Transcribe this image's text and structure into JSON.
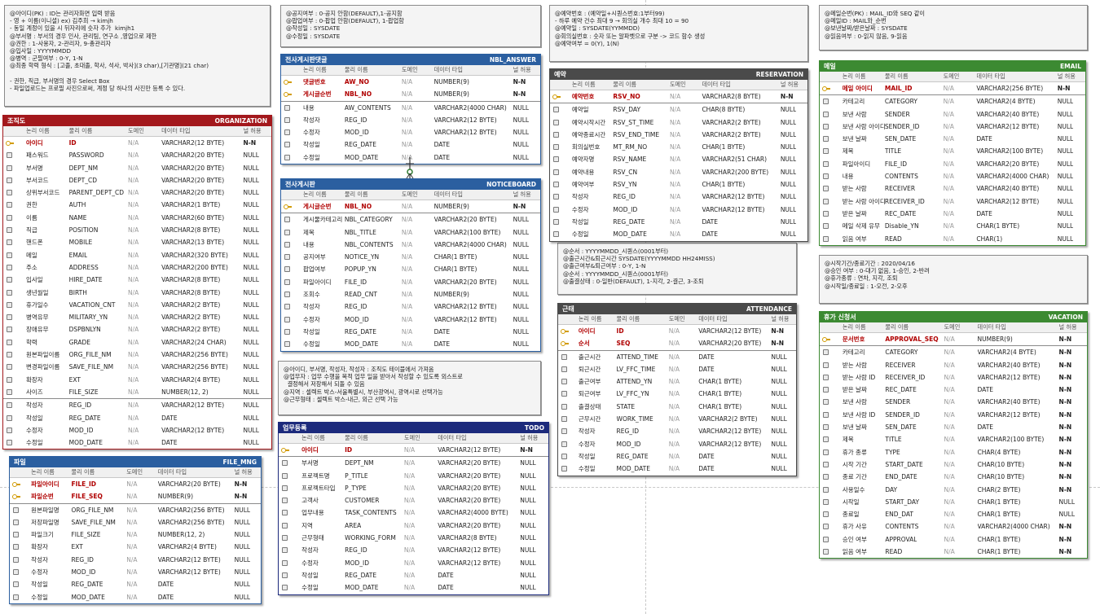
{
  "colors": {
    "red": "#a3181c",
    "blue": "#2b5fa0",
    "dark": "#4a4a4a",
    "green": "#3c8a32",
    "navy": "#1c2a7c"
  },
  "columns_header": [
    "논리 이름",
    "물리 이름",
    "도메인",
    "데이터 타입",
    "널 허용"
  ],
  "notes": {
    "org": [
      "@아이디(PK) : ID는 관리자화면 입력 받음",
      "- 영 + 이름(이니셜) ex) 김주희 → kimjh",
      "- 동일 계정이 있을 시 뒤자리에 숫자 추가  kimjh1",
      "@부서명 : 부서의 경우 인사, 관리팀, 연구소 ,영업으로 제한",
      "@권한 : 1-사용자, 2-관리자, 9-총관리자",
      "@입사일 : YYYYMMDD",
      "@병역 : 군필여부 : 0-Y, 1-N",
      "@최종 학력 형식 : [고졸, 초대졸, 학사, 석사, 박사](3 char),[기관명](21 char)",
      "",
      "- 권한, 직급, 부서명의 경우 Select Box",
      "- 파일업로드는 프로필 사진으로써, 계정 당 하나의 사진만 등록 수 있다."
    ],
    "notice_answer": [
      "@공지여부 : 0-공지 안함(DEFAULT),1-공지함",
      "@팝업여부 : 0-팝업 안함(DEFAULT), 1-팝업함",
      "@작성일 : SYSDATE",
      "@수정일 : SYSDATE"
    ],
    "reservation": [
      "@예약번호 : (예약일+시퀀스번호:1부터99)",
      "- 하루 예약 건수 최대 9 → 회의실 개수 최대 10 = 90",
      "@예약일 : SYSDATE(YYMMDD)",
      "@회의실번호 : 숫자 또는 알파벳으로 구분 -> 코드 함수 생성",
      "@예약여부 = 0(Y), 1(N)"
    ],
    "email": [
      "@메일순번(PK) : MAIL_ID와 SEQ 같이",
      "@메일ID : MAIL와_순번",
      "@보낸날짜/받은날짜 : SYSDATE",
      "@읽음여부 : 0-읽지 않음, 9-읽음"
    ],
    "todo": [
      "@아이디, 부서명, 작성자, 작성자 : 조직도 테이블에서 가져옴",
      "@업무자 : 업무 수행을 목적 업무 일을 받아서 작성할 수 있도록 외스트로",
      "  결정해서 저장해서 되돌 수 있음",
      "@지역 : 셀렉트 박스-서울특별시, 부산광역시, 광역시로 선택가능",
      "@근무형태 : 셀렉트 박스-내근, 외근 선택 가능"
    ],
    "attendance": [
      "@순서 : YYYYMMDD_시퀀스(0001부터)",
      "@출근시간&퇴근시간 SYSDATE(YYYYMMDD HH24MISS)",
      "@출근여부&퇴근여부 : 0-Y, 1-N",
      "@순서 : YYYYMMDD_시퀀스(0001부터)",
      "@출결상태 : 0-일반(DEFAULT), 1-지각, 2-결근, 3-조퇴"
    ],
    "vacation": [
      "@시작기간/종료기간 : 2020/04/16",
      "@승인 여부 : 0-대기 없음, 1-승인, 2-반려",
      "@휴가종류 : 연차, 지각, 조퇴",
      "@시작일/종료일 : 1-오전, 2-오후"
    ]
  },
  "entities": {
    "organization": {
      "kname": "조직도",
      "pname": "ORGANIZATION",
      "rows": [
        [
          "아이디",
          "ID",
          "N/A",
          "VARCHAR2(12 BYTE)",
          "N-N",
          "pk"
        ],
        [
          "패스워드",
          "PASSWORD",
          "N/A",
          "VARCHAR2(20 BYTE)",
          "NULL",
          ""
        ],
        [
          "부서명",
          "DEPT_NM",
          "N/A",
          "VARCHAR2(20 BYTE)",
          "NULL",
          ""
        ],
        [
          "부서코드",
          "DEPT_CD",
          "N/A",
          "VARCHAR2(20 BYTE)",
          "NULL",
          ""
        ],
        [
          "상위부서코드",
          "PARENT_DEPT_CD",
          "N/A",
          "VARCHAR2(20 BYTE)",
          "NULL",
          ""
        ],
        [
          "권한",
          "AUTH",
          "N/A",
          "VARCHAR2(1 BYTE)",
          "NULL",
          ""
        ],
        [
          "이름",
          "NAME",
          "N/A",
          "VARCHAR2(60 BYTE)",
          "NULL",
          ""
        ],
        [
          "직급",
          "POSITION",
          "N/A",
          "VARCHAR2(8 BYTE)",
          "NULL",
          ""
        ],
        [
          "핸드폰",
          "MOBILE",
          "N/A",
          "VARCHAR2(13 BYTE)",
          "NULL",
          ""
        ],
        [
          "메일",
          "EMAIL",
          "N/A",
          "VARCHAR2(320 BYTE)",
          "NULL",
          ""
        ],
        [
          "주소",
          "ADDRESS",
          "N/A",
          "VARCHAR2(200 BYTE)",
          "NULL",
          ""
        ],
        [
          "입사일",
          "HIRE_DATE",
          "N/A",
          "VARCHAR2(8 BYTE)",
          "NULL",
          ""
        ],
        [
          "생년월일",
          "BIRTH",
          "N/A",
          "VARCHAR2(8 BYTE)",
          "NULL",
          ""
        ],
        [
          "휴가일수",
          "VACATION_CNT",
          "N/A",
          "VARCHAR2(2 BYTE)",
          "NULL",
          ""
        ],
        [
          "병역유무",
          "MILITARY_YN",
          "N/A",
          "VARCHAR2(2 BYTE)",
          "NULL",
          ""
        ],
        [
          "장애유무",
          "DSPBNLYN",
          "N/A",
          "VARCHAR2(2 BYTE)",
          "NULL",
          ""
        ],
        [
          "학력",
          "GRADE",
          "N/A",
          "VARCHAR2(24 CHAR)",
          "NULL",
          ""
        ],
        [
          "원본파일이름",
          "ORG_FILE_NM",
          "N/A",
          "VARCHAR2(256 BYTE)",
          "NULL",
          ""
        ],
        [
          "변경파일이름",
          "SAVE_FILE_NM",
          "N/A",
          "VARCHAR2(256 BYTE)",
          "NULL",
          ""
        ],
        [
          "확장자",
          "EXT",
          "N/A",
          "VARCHAR2(4 BYTE)",
          "NULL",
          ""
        ],
        [
          "사이즈",
          "FILE_SIZE",
          "N/A",
          "NUMBER(12, 2)",
          "NULL",
          ""
        ],
        [
          "작성자",
          "REG_ID",
          "N/A",
          "VARCHAR2(12 BYTE)",
          "NULL",
          "sep"
        ],
        [
          "작성일",
          "REG_DATE",
          "N/A",
          "DATE",
          "NULL",
          ""
        ],
        [
          "수정자",
          "MOD_ID",
          "N/A",
          "VARCHAR2(12 BYTE)",
          "NULL",
          ""
        ],
        [
          "수정일",
          "MOD_DATE",
          "N/A",
          "DATE",
          "NULL",
          ""
        ]
      ]
    },
    "file_mng": {
      "kname": "파일",
      "pname": "FILE_MNG",
      "rows": [
        [
          "파일아이디",
          "FILE_ID",
          "N/A",
          "VARCHAR2(20 BYTE)",
          "N-N",
          "pk"
        ],
        [
          "파일순번",
          "FILE_SEQ",
          "N/A",
          "NUMBER(9)",
          "N-N",
          "pk"
        ],
        [
          "원본파일명",
          "ORG_FILE_NM",
          "N/A",
          "VARCHAR2(256 BYTE)",
          "NULL",
          "sep"
        ],
        [
          "저장파일명",
          "SAVE_FILE_NM",
          "N/A",
          "VARCHAR2(256 BYTE)",
          "NULL",
          ""
        ],
        [
          "파일크기",
          "FILE_SIZE",
          "N/A",
          "NUMBER(12, 2)",
          "NULL",
          ""
        ],
        [
          "확장자",
          "EXT",
          "N/A",
          "VARCHAR2(4 BYTE)",
          "NULL",
          ""
        ],
        [
          "작성자",
          "REG_ID",
          "N/A",
          "VARCHAR2(12 BYTE)",
          "NULL",
          ""
        ],
        [
          "수정자",
          "MOD_ID",
          "N/A",
          "VARCHAR2(12 BYTE)",
          "NULL",
          ""
        ],
        [
          "작성일",
          "REG_DATE",
          "N/A",
          "DATE",
          "NULL",
          ""
        ],
        [
          "수정일",
          "MOD_DATE",
          "N/A",
          "DATE",
          "NULL",
          ""
        ]
      ]
    },
    "nbl_answer": {
      "kname": "전사게시판댓글",
      "pname": "NBL_ANSWER",
      "rows": [
        [
          "댓글번호",
          "AW_NO",
          "N/A",
          "NUMBER(9)",
          "N-N",
          "pk"
        ],
        [
          "게시글순번",
          "NBL_NO",
          "N/A",
          "NUMBER(9)",
          "N-N",
          "fk"
        ],
        [
          "내용",
          "AW_CONTENTS",
          "N/A",
          "VARCHAR2(4000 CHAR)",
          "NULL",
          "sep"
        ],
        [
          "작성자",
          "REG_ID",
          "N/A",
          "VARCHAR2(12 BYTE)",
          "NULL",
          ""
        ],
        [
          "수정자",
          "MOD_ID",
          "N/A",
          "VARCHAR2(12 BYTE)",
          "NULL",
          ""
        ],
        [
          "작성일",
          "REG_DATE",
          "N/A",
          "DATE",
          "NULL",
          ""
        ],
        [
          "수정일",
          "MOD_DATE",
          "N/A",
          "DATE",
          "NULL",
          ""
        ]
      ]
    },
    "noticeboard": {
      "kname": "전사게시판",
      "pname": "NOTICEBOARD",
      "rows": [
        [
          "게시글순번",
          "NBL_NO",
          "N/A",
          "NUMBER(9)",
          "N-N",
          "pk"
        ],
        [
          "게시물카테고리",
          "NBL_CATEGORY",
          "N/A",
          "VARCHAR2(20 BYTE)",
          "NULL",
          "sep"
        ],
        [
          "제목",
          "NBL_TITLE",
          "N/A",
          "VARCHAR2(100 BYTE)",
          "NULL",
          ""
        ],
        [
          "내용",
          "NBL_CONTENTS",
          "N/A",
          "VARCHAR2(4000 CHAR)",
          "NULL",
          ""
        ],
        [
          "공지여부",
          "NOTICE_YN",
          "N/A",
          "CHAR(1 BYTE)",
          "NULL",
          ""
        ],
        [
          "팝업여부",
          "POPUP_YN",
          "N/A",
          "CHAR(1 BYTE)",
          "NULL",
          ""
        ],
        [
          "파일아이디",
          "FILE_ID",
          "N/A",
          "VARCHAR2(20 BYTE)",
          "NULL",
          ""
        ],
        [
          "조회수",
          "READ_CNT",
          "N/A",
          "NUMBER(9)",
          "NULL",
          ""
        ],
        [
          "작성자",
          "REG_ID",
          "N/A",
          "VARCHAR2(12 BYTE)",
          "NULL",
          ""
        ],
        [
          "수정자",
          "MOD_ID",
          "N/A",
          "VARCHAR2(12 BYTE)",
          "NULL",
          ""
        ],
        [
          "작성일",
          "REG_DATE",
          "N/A",
          "DATE",
          "NULL",
          ""
        ],
        [
          "수정일",
          "MOD_DATE",
          "N/A",
          "DATE",
          "NULL",
          ""
        ]
      ]
    },
    "todo": {
      "kname": "업무등록",
      "pname": "TODO",
      "rows": [
        [
          "아이디",
          "ID",
          "N/A",
          "VARCHAR2(12 BYTE)",
          "N-N",
          "pk"
        ],
        [
          "부서명",
          "DEPT_NM",
          "N/A",
          "VARCHAR2(20 BYTE)",
          "NULL",
          "sep"
        ],
        [
          "프로젝트명",
          "P_TITLE",
          "N/A",
          "VARCHAR2(20 BYTE)",
          "NULL",
          ""
        ],
        [
          "프로젝트타입",
          "P_TYPE",
          "N/A",
          "VARCHAR2(20 BYTE)",
          "NULL",
          ""
        ],
        [
          "고객사",
          "CUSTOMER",
          "N/A",
          "VARCHAR2(20 BYTE)",
          "NULL",
          ""
        ],
        [
          "업무내용",
          "TASK_CONTENTS",
          "N/A",
          "VARCHAR2(4000 BYTE)",
          "NULL",
          ""
        ],
        [
          "지역",
          "AREA",
          "N/A",
          "VARCHAR2(20 BYTE)",
          "NULL",
          ""
        ],
        [
          "근무형태",
          "WORKING_FORM",
          "N/A",
          "VARCHAR2(8 BYTE)",
          "NULL",
          ""
        ],
        [
          "작성자",
          "REG_ID",
          "N/A",
          "VARCHAR2(12 BYTE)",
          "NULL",
          ""
        ],
        [
          "수정자",
          "MOD_ID",
          "N/A",
          "VARCHAR2(12 BYTE)",
          "NULL",
          ""
        ],
        [
          "작성일",
          "REG_DATE",
          "N/A",
          "DATE",
          "NULL",
          ""
        ],
        [
          "수정일",
          "MOD_DATE",
          "N/A",
          "DATE",
          "NULL",
          ""
        ]
      ]
    },
    "reservation": {
      "kname": "예약",
      "pname": "RESERVATION",
      "rows": [
        [
          "예약번호",
          "RSV_NO",
          "N/A",
          "VARCHAR2(8 BYTE)",
          "N-N",
          "pk"
        ],
        [
          "예약일",
          "RSV_DAY",
          "N/A",
          "CHAR(8 BYTE)",
          "NULL",
          "sep"
        ],
        [
          "예약시작시간",
          "RSV_ST_TIME",
          "N/A",
          "VARCHAR2(2 BYTE)",
          "NULL",
          ""
        ],
        [
          "예약종료시간",
          "RSV_END_TIME",
          "N/A",
          "VARCHAR2(2 BYTE)",
          "NULL",
          ""
        ],
        [
          "회의실번호",
          "MT_RM_NO",
          "N/A",
          "CHAR(1 BYTE)",
          "NULL",
          ""
        ],
        [
          "예약자명",
          "RSV_NAME",
          "N/A",
          "VARCHAR2(51 CHAR)",
          "NULL",
          ""
        ],
        [
          "예약내용",
          "RSV_CN",
          "N/A",
          "VARCHAR2(200 BYTE)",
          "NULL",
          ""
        ],
        [
          "예약여부",
          "RSV_YN",
          "N/A",
          "CHAR(1 BYTE)",
          "NULL",
          ""
        ],
        [
          "작성자",
          "REG_ID",
          "N/A",
          "VARCHAR2(12 BYTE)",
          "NULL",
          ""
        ],
        [
          "수정자",
          "MOD_ID",
          "N/A",
          "VARCHAR2(12 BYTE)",
          "NULL",
          ""
        ],
        [
          "작성일",
          "REG_DATE",
          "N/A",
          "DATE",
          "NULL",
          ""
        ],
        [
          "수정일",
          "MOD_DATE",
          "N/A",
          "DATE",
          "NULL",
          ""
        ]
      ]
    },
    "attendance": {
      "kname": "근태",
      "pname": "ATTENDANCE",
      "rows": [
        [
          "아이디",
          "ID",
          "N/A",
          "VARCHAR2(12 BYTE)",
          "N-N",
          "pk"
        ],
        [
          "순서",
          "SEQ",
          "N/A",
          "VARCHAR2(20 BYTE)",
          "N-N",
          "pk"
        ],
        [
          "출근시간",
          "ATTEND_TIME",
          "N/A",
          "DATE",
          "NULL",
          "sep"
        ],
        [
          "퇴근시간",
          "LV_FFC_TIME",
          "N/A",
          "DATE",
          "NULL",
          ""
        ],
        [
          "출근여부",
          "ATTEND_YN",
          "N/A",
          "CHAR(1 BYTE)",
          "NULL",
          ""
        ],
        [
          "퇴근여부",
          "LV_FFC_YN",
          "N/A",
          "CHAR(1 BYTE)",
          "NULL",
          ""
        ],
        [
          "출결상태",
          "STATE",
          "N/A",
          "CHAR(1 BYTE)",
          "NULL",
          ""
        ],
        [
          "근무시간",
          "WORK_TIME",
          "N/A",
          "VARCHAR2(2 BYTE)",
          "NULL",
          ""
        ],
        [
          "작성자",
          "REG_ID",
          "N/A",
          "VARCHAR2(12 BYTE)",
          "NULL",
          ""
        ],
        [
          "수정자",
          "MOD_ID",
          "N/A",
          "VARCHAR2(12 BYTE)",
          "NULL",
          ""
        ],
        [
          "작성일",
          "REG_DATE",
          "N/A",
          "DATE",
          "NULL",
          ""
        ],
        [
          "수정일",
          "MOD_DATE",
          "N/A",
          "DATE",
          "NULL",
          ""
        ]
      ]
    },
    "email": {
      "kname": "메일",
      "pname": "EMAIL",
      "rows": [
        [
          "메일 아이디",
          "MAIL_ID",
          "N/A",
          "VARCHAR2(256 BYTE)",
          "N-N",
          "pk"
        ],
        [
          "카테고리",
          "CATEGORY",
          "N/A",
          "VARCHAR2(4 BYTE)",
          "NULL",
          "sep"
        ],
        [
          "보낸 사람",
          "SENDER",
          "N/A",
          "VARCHAR2(40 BYTE)",
          "NULL",
          ""
        ],
        [
          "보낸 사람 아이디",
          "SENDER_ID",
          "N/A",
          "VARCHAR2(12 BYTE)",
          "NULL",
          ""
        ],
        [
          "보낸 날짜",
          "SEN_DATE",
          "N/A",
          "DATE",
          "NULL",
          ""
        ],
        [
          "제목",
          "TITLE",
          "N/A",
          "VARCHAR2(100 BYTE)",
          "NULL",
          ""
        ],
        [
          "파일아이디",
          "FILE_ID",
          "N/A",
          "VARCHAR2(20 BYTE)",
          "NULL",
          ""
        ],
        [
          "내용",
          "CONTENTS",
          "N/A",
          "VARCHAR2(4000 CHAR)",
          "NULL",
          ""
        ],
        [
          "받는 사람",
          "RECEIVER",
          "N/A",
          "VARCHAR2(40 BYTE)",
          "NULL",
          ""
        ],
        [
          "받는 사람 아이디",
          "RECEIVER_ID",
          "N/A",
          "VARCHAR2(12 BYTE)",
          "NULL",
          ""
        ],
        [
          "받은 날짜",
          "REC_DATE",
          "N/A",
          "DATE",
          "NULL",
          ""
        ],
        [
          "메일 삭제 유무",
          "Disable_YN",
          "N/A",
          "CHAR(1 BYTE)",
          "NULL",
          ""
        ],
        [
          "읽음 여부",
          "READ",
          "N/A",
          "CHAR(1)",
          "NULL",
          ""
        ]
      ]
    },
    "vacation": {
      "kname": "휴가 신청서",
      "pname": "VACATION",
      "rows": [
        [
          "문서번호",
          "APPROVAL_SEQ",
          "N/A",
          "NUMBER(9)",
          "N-N",
          "pk"
        ],
        [
          "카테고리",
          "CATEGORY",
          "N/A",
          "VARCHAR2(4 BYTE)",
          "N-N",
          "sep"
        ],
        [
          "받는 사람",
          "RECEIVER",
          "N/A",
          "VARCHAR2(40 BYTE)",
          "N-N",
          ""
        ],
        [
          "받는 사람 ID",
          "RECEIVER_ID",
          "N/A",
          "VARCHAR2(12 BYTE)",
          "N-N",
          ""
        ],
        [
          "받은 날짜",
          "REC_DATE",
          "N/A",
          "DATE",
          "N-N",
          ""
        ],
        [
          "보낸 사람",
          "SENDER",
          "N/A",
          "VARCHAR2(40 BYTE)",
          "N-N",
          ""
        ],
        [
          "보낸 사람 ID",
          "SENDER_ID",
          "N/A",
          "VARCHAR2(12 BYTE)",
          "N-N",
          ""
        ],
        [
          "보낸 날짜",
          "SEN_DATE",
          "N/A",
          "DATE",
          "N-N",
          ""
        ],
        [
          "제목",
          "TITLE",
          "N/A",
          "VARCHAR2(100 BYTE)",
          "N-N",
          ""
        ],
        [
          "휴가 종류",
          "TYPE",
          "N/A",
          "CHAR(4 BYTE)",
          "N-N",
          ""
        ],
        [
          "시작 기간",
          "START_DATE",
          "N/A",
          "CHAR(10 BYTE)",
          "N-N",
          ""
        ],
        [
          "종료 기간",
          "END_DATE",
          "N/A",
          "CHAR(10 BYTE)",
          "N-N",
          ""
        ],
        [
          "사용일수",
          "DAY",
          "N/A",
          "CHAR(2 BYTE)",
          "N-N",
          ""
        ],
        [
          "시작일",
          "START_DAY",
          "N/A",
          "CHAR(1 BYTE)",
          "NULL",
          ""
        ],
        [
          "종료일",
          "END_DAT",
          "N/A",
          "CHAR(1 BYTE)",
          "NULL",
          ""
        ],
        [
          "휴가 사유",
          "CONTENTS",
          "N/A",
          "VARCHAR2(4000 CHAR)",
          "N-N",
          ""
        ],
        [
          "승인 여부",
          "APPROVAL",
          "N/A",
          "CHAR(1 BYTE)",
          "N-N",
          ""
        ],
        [
          "읽음 여부",
          "READ",
          "N/A",
          "CHAR(1 BYTE)",
          "N-N",
          ""
        ]
      ]
    }
  }
}
